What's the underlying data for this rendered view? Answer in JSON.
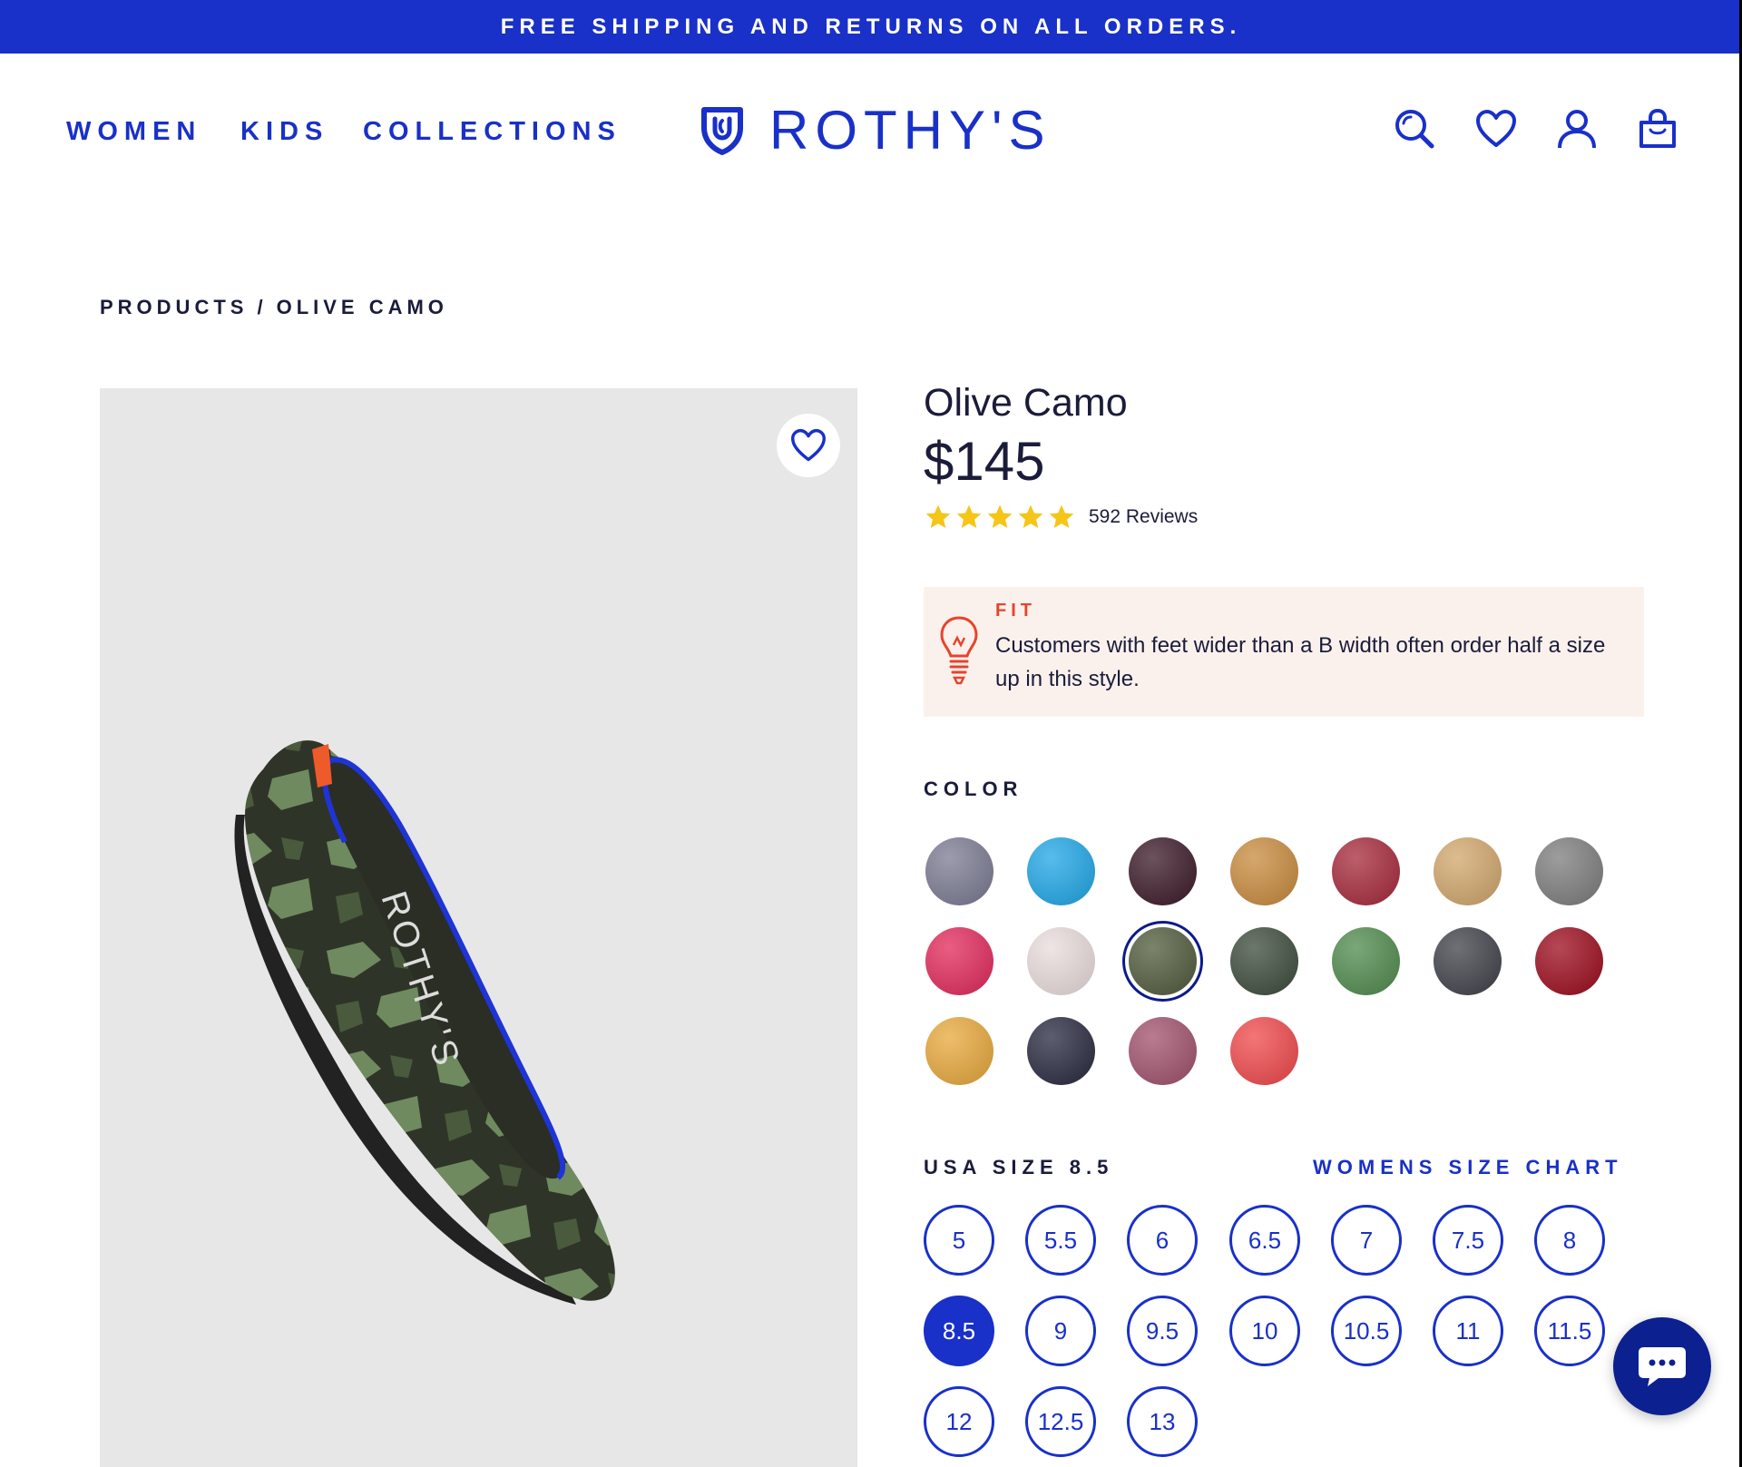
{
  "announcement": "FREE SHIPPING AND RETURNS ON ALL ORDERS.",
  "nav": {
    "items": [
      "WOMEN",
      "KIDS",
      "COLLECTIONS"
    ]
  },
  "brand": {
    "name": "ROTHY'S"
  },
  "header_icons": [
    "search-icon",
    "heart-icon",
    "account-icon",
    "bag-icon"
  ],
  "breadcrumb": {
    "root": "PRODUCTS",
    "separator": "/",
    "current": "OLIVE CAMO"
  },
  "product": {
    "title": "Olive Camo",
    "price": "$145",
    "rating": 5,
    "reviews": "592 Reviews",
    "fit": {
      "label": "FIT",
      "text": "Customers with feet wider than a B width often order half a size up in this style."
    }
  },
  "color": {
    "label": "COLOR",
    "swatches": [
      {
        "name": "heather-multi",
        "color": "#7a7a92",
        "selected": false
      },
      {
        "name": "bright-blue",
        "color": "#1ea6e6",
        "selected": false
      },
      {
        "name": "black-cherry",
        "color": "#3a1826",
        "selected": false
      },
      {
        "name": "leopard",
        "color": "#c88a3c",
        "selected": false
      },
      {
        "name": "burgundy",
        "color": "#a6283a",
        "selected": false
      },
      {
        "name": "cheetah",
        "color": "#d1a66a",
        "selected": false
      },
      {
        "name": "gray-knit",
        "color": "#7c7c7c",
        "selected": false
      },
      {
        "name": "pink-multi",
        "color": "#e2285a",
        "selected": false
      },
      {
        "name": "blush",
        "color": "#eadcdc",
        "selected": false
      },
      {
        "name": "olive-camo",
        "color": "#4f5a3a",
        "selected": true
      },
      {
        "name": "dark-camo",
        "color": "#3a4a3a",
        "selected": false
      },
      {
        "name": "green",
        "color": "#4f8a4c",
        "selected": false
      },
      {
        "name": "charcoal-camo",
        "color": "#3e4048",
        "selected": false
      },
      {
        "name": "crimson",
        "color": "#9c0a1c",
        "selected": false
      },
      {
        "name": "mustard",
        "color": "#e8a83a",
        "selected": false
      },
      {
        "name": "navy",
        "color": "#26283e",
        "selected": false
      },
      {
        "name": "berry-multi",
        "color": "#a0506a",
        "selected": false
      },
      {
        "name": "coral-red",
        "color": "#f0474a",
        "selected": false
      }
    ]
  },
  "size": {
    "label": "USA SIZE 8.5",
    "chart_link": "WOMENS SIZE CHART",
    "options": [
      "5",
      "5.5",
      "6",
      "6.5",
      "7",
      "7.5",
      "8",
      "8.5",
      "9",
      "9.5",
      "10",
      "10.5",
      "11",
      "11.5",
      "12",
      "12.5",
      "13"
    ],
    "selected": "8.5"
  },
  "colors": {
    "brand_blue": "#1930c9",
    "chat_navy": "#0c2090",
    "fit_red": "#e8432c",
    "star_yellow": "#f5c518"
  }
}
